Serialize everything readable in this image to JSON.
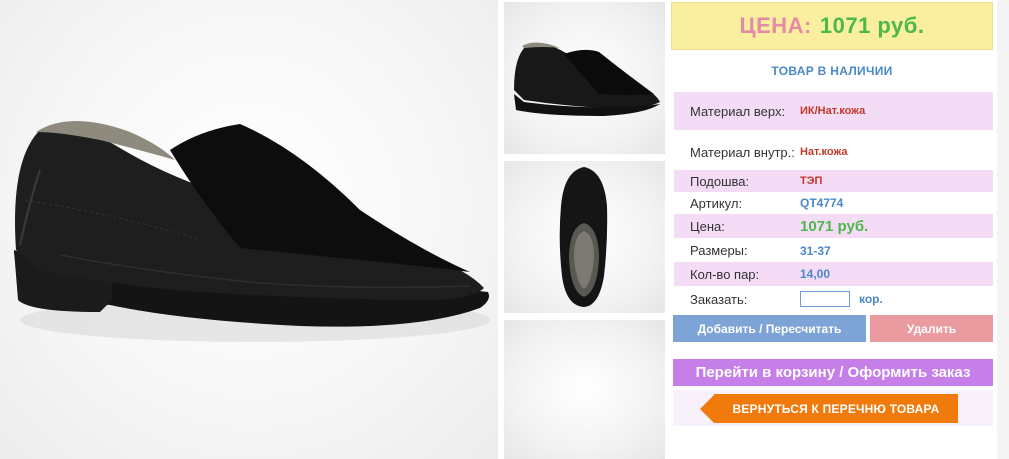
{
  "product": {
    "price_label": "ЦЕНА:",
    "price_value": "1071 руб.",
    "stock_status": "ТОВАР В НАЛИЧИИ"
  },
  "specs": [
    {
      "key": "Материал верх:",
      "value": "ИК/Нат.кожа"
    },
    {
      "key": "Материал внутр.:",
      "value": "Нат.кожа"
    },
    {
      "key": "Подошва:",
      "value": "ТЭП"
    },
    {
      "key": "Артикул:",
      "value": "QT4774"
    },
    {
      "key": "Цена:",
      "value": "1071 руб."
    },
    {
      "key": "Размеры:",
      "value": "31-37"
    },
    {
      "key": "Кол-во пар:",
      "value": "14,00"
    }
  ],
  "order": {
    "label": "Заказать:",
    "input_value": "",
    "unit": "кор."
  },
  "buttons": {
    "add": "Добавить / Пересчитать",
    "delete": "Удалить",
    "cart": "Перейти в корзину / Оформить заказ",
    "back": "ВЕРНУТЬСЯ К ПЕРЕЧНЮ ТОВАРА"
  },
  "colors": {
    "price_box_bg": "#f9ef9e",
    "price_label": "#e58aa6",
    "price_value": "#4cb84a",
    "spec_row_pink": "#f4dcf7",
    "add_button": "#7ea3d6",
    "delete_button": "#ea9b9f",
    "cart_button": "#c67ee8",
    "back_button": "#f07b0c"
  },
  "icons": {
    "back_arrow": "arrow-left-icon"
  }
}
